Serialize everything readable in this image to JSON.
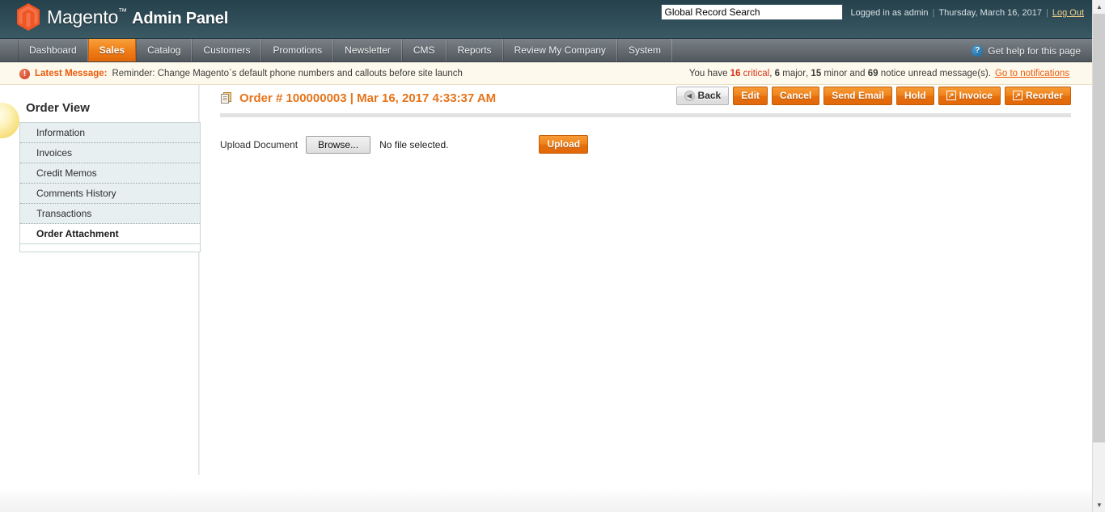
{
  "header": {
    "logo_text_brand": "Magento",
    "logo_trademark": "™",
    "logo_text_admin": "Admin Panel",
    "search_value": "Global Record Search",
    "search_placeholder": "Global Record Search",
    "logged_in_as": "Logged in as admin",
    "separator": "|",
    "date": "Thursday, March 16, 2017",
    "logout_label": "Log Out"
  },
  "nav": {
    "items": [
      {
        "label": "Dashboard",
        "active": false
      },
      {
        "label": "Sales",
        "active": true
      },
      {
        "label": "Catalog",
        "active": false
      },
      {
        "label": "Customers",
        "active": false
      },
      {
        "label": "Promotions",
        "active": false
      },
      {
        "label": "Newsletter",
        "active": false
      },
      {
        "label": "CMS",
        "active": false
      },
      {
        "label": "Reports",
        "active": false
      },
      {
        "label": "Review My Company",
        "active": false
      },
      {
        "label": "System",
        "active": false
      }
    ],
    "help_label": "Get help for this page",
    "help_icon_glyph": "?"
  },
  "message_bar": {
    "alert_icon_glyph": "!",
    "label": "Latest Message:",
    "text": "Reminder: Change Magento`s default phone numbers and callouts before site launch",
    "counts_prefix": "You have",
    "critical_count": "16",
    "critical_word": "critical",
    "major_count": "6",
    "major_word": "major",
    "minor_count": "15",
    "minor_word": "minor",
    "and_word": "and",
    "notice_count": "69",
    "notice_word": "notice unread message(s).",
    "link_label": "Go to notifications"
  },
  "sidebar": {
    "title": "Order View",
    "items": [
      {
        "label": "Information",
        "current": false
      },
      {
        "label": "Invoices",
        "current": false
      },
      {
        "label": "Credit Memos",
        "current": false
      },
      {
        "label": "Comments History",
        "current": false
      },
      {
        "label": "Transactions",
        "current": false
      },
      {
        "label": "Order Attachment",
        "current": true
      }
    ]
  },
  "main": {
    "page_title": "Order # 100000003 | Mar 16, 2017 4:33:37 AM",
    "buttons": [
      {
        "label": "Back",
        "style": "back",
        "icon": "left-arrow-icon"
      },
      {
        "label": "Edit",
        "style": "primary",
        "icon": ""
      },
      {
        "label": "Cancel",
        "style": "primary",
        "icon": ""
      },
      {
        "label": "Send Email",
        "style": "primary",
        "icon": ""
      },
      {
        "label": "Hold",
        "style": "primary",
        "icon": ""
      },
      {
        "label": "Invoice",
        "style": "primary",
        "icon": "popup-window-icon"
      },
      {
        "label": "Reorder",
        "style": "primary",
        "icon": "popup-window-icon"
      }
    ],
    "upload": {
      "label": "Upload Document",
      "browse_label": "Browse...",
      "file_status": "No file selected.",
      "upload_label": "Upload"
    }
  },
  "scrollbar": {
    "up_glyph": "▲",
    "down_glyph": "▼"
  },
  "colors": {
    "accent_orange": "#e7741a",
    "header_dark": "#2d4a55",
    "nav_gray": "#6b7278",
    "msgbar_cream": "#fdf9ec",
    "sidebar_blue": "#e7eff0",
    "critical_red": "#d6341a"
  }
}
